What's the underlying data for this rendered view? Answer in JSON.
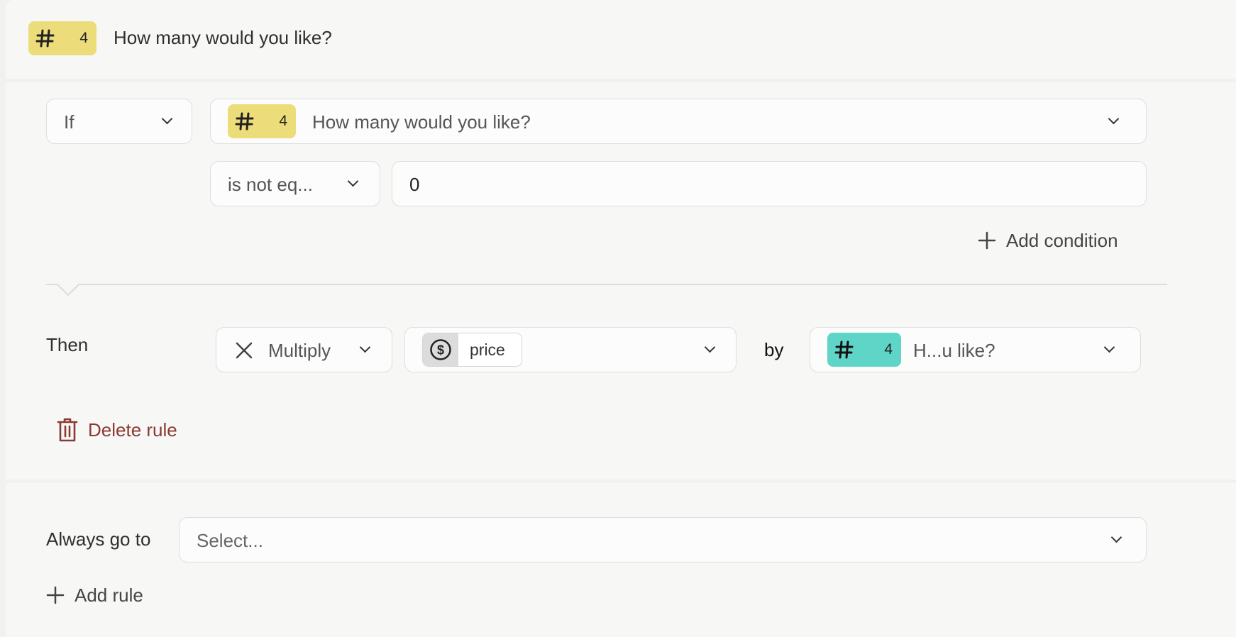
{
  "header": {
    "question_number": "4",
    "question_title": "How many would you like?"
  },
  "condition": {
    "if_label": "If",
    "question_number": "4",
    "question_title": "How many would you like?",
    "operator": "is not eq...",
    "value": "0",
    "add_condition_label": "Add condition"
  },
  "action": {
    "then_label": "Then",
    "operation": "Multiply",
    "variable": "price",
    "by_label": "by",
    "question_number": "4",
    "question_title": "H...u like?"
  },
  "delete_rule_label": "Delete rule",
  "footer": {
    "always_go_to_label": "Always go to",
    "select_placeholder": "Select...",
    "add_rule_label": "Add rule"
  },
  "colors": {
    "number_badge": "#ecdc7a",
    "number_badge_answer": "#5fd5c7",
    "danger_text": "#8a3a33"
  }
}
